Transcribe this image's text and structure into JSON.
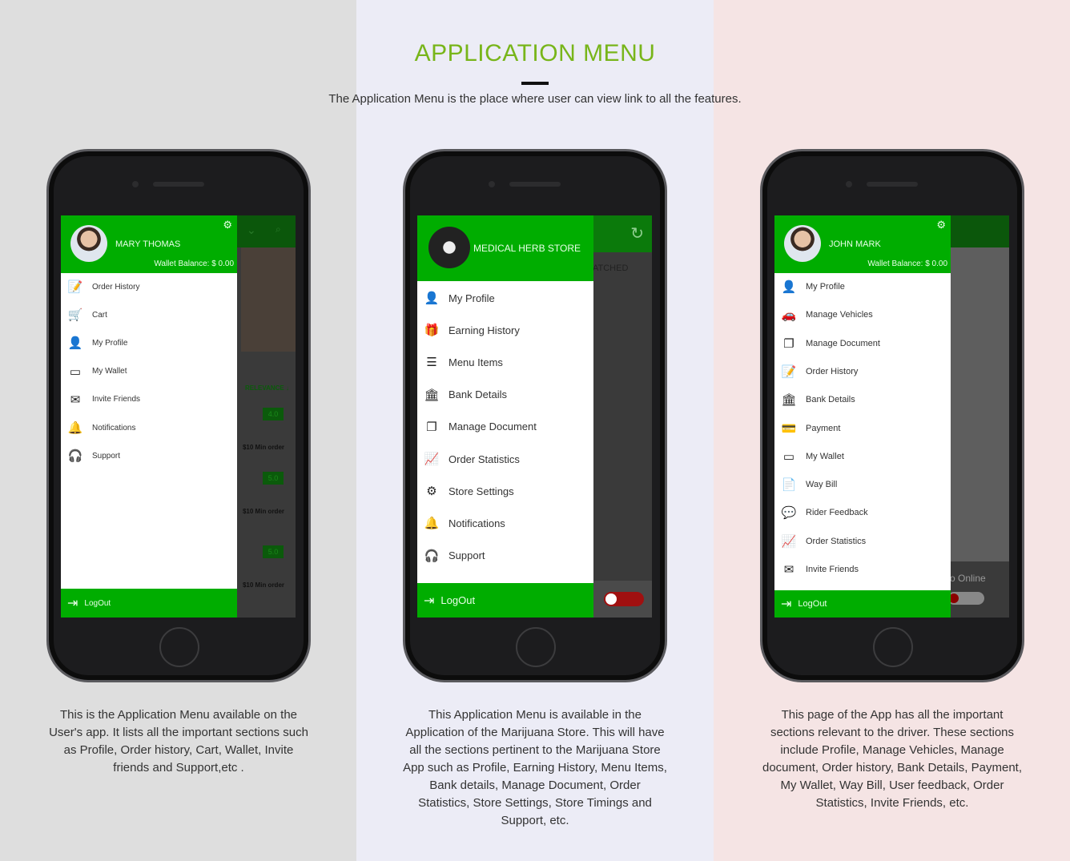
{
  "header": {
    "title": "APPLICATION MENU",
    "subtitle": "The Application Menu is the place where user can view link to all the features."
  },
  "colors": {
    "accent": "#78b51a",
    "drawer_green": "#00ad00"
  },
  "phones": [
    {
      "user": "MARY THOMAS",
      "wallet": "Wallet Balance: $ 0.00",
      "settings_icon": "gear-icon",
      "items": [
        {
          "label": "Order History",
          "icon": "clipboard-icon"
        },
        {
          "label": "Cart",
          "icon": "cart-icon"
        },
        {
          "label": "My Profile",
          "icon": "user-icon"
        },
        {
          "label": "My Wallet",
          "icon": "wallet-icon"
        },
        {
          "label": "Invite Friends",
          "icon": "envelope-icon"
        },
        {
          "label": "Notifications",
          "icon": "bell-icon"
        },
        {
          "label": "Support",
          "icon": "support-icon"
        }
      ],
      "logout": "LogOut",
      "background": {
        "sort": "RELEVANCE ↓",
        "ratings": [
          "4.0",
          "5.0",
          "5.0"
        ],
        "min_order": [
          "$10 Min order",
          "$10 Min order",
          "$10 Min order"
        ]
      },
      "description": "This is the Application Menu available on the User's app. It lists all the important sections such as Profile, Order history, Cart, Wallet, Invite friends and Support,etc ."
    },
    {
      "user": "MEDICAL HERB STORE",
      "items": [
        {
          "label": "My Profile",
          "icon": "user-icon"
        },
        {
          "label": "Earning History",
          "icon": "gift-icon"
        },
        {
          "label": "Menu Items",
          "icon": "list-icon"
        },
        {
          "label": "Bank Details",
          "icon": "bank-icon"
        },
        {
          "label": "Manage Document",
          "icon": "document-icon"
        },
        {
          "label": "Order Statistics",
          "icon": "chart-icon"
        },
        {
          "label": "Store Settings",
          "icon": "gear-icon"
        },
        {
          "label": "Notifications",
          "icon": "bell-icon"
        },
        {
          "label": "Support",
          "icon": "support-icon"
        }
      ],
      "logout": "LogOut",
      "background": {
        "tab": "ATCHED",
        "refresh_icon": "refresh-icon"
      },
      "description": "This Application Menu is available in the Application of the Marijuana Store. This will have all the sections pertinent to the Marijuana Store App such as Profile, Earning History, Menu Items, Bank details, Manage Document, Order Statistics, Store Settings, Store Timings and Support, etc."
    },
    {
      "user": "JOHN MARK",
      "wallet": "Wallet Balance: $ 0.00",
      "settings_icon": "gear-icon",
      "items": [
        {
          "label": "My Profile",
          "icon": "user-icon"
        },
        {
          "label": "Manage Vehicles",
          "icon": "car-icon"
        },
        {
          "label": "Manage Document",
          "icon": "document-icon"
        },
        {
          "label": "Order History",
          "icon": "clipboard-icon"
        },
        {
          "label": "Bank Details",
          "icon": "bank-icon"
        },
        {
          "label": "Payment",
          "icon": "card-icon"
        },
        {
          "label": "My Wallet",
          "icon": "wallet-icon"
        },
        {
          "label": "Way Bill",
          "icon": "bill-icon"
        },
        {
          "label": "Rider Feedback",
          "icon": "feedback-icon"
        },
        {
          "label": "Order Statistics",
          "icon": "chart-icon"
        },
        {
          "label": "Invite Friends",
          "icon": "envelope-icon"
        }
      ],
      "logout": "LogOut",
      "background": {
        "online": "o Online"
      },
      "description": "This page of the App has all the important sections relevant to the driver. These sections include Profile, Manage Vehicles, Manage document, Order history, Bank Details, Payment, My Wallet, Way Bill, User feedback, Order Statistics, Invite Friends, etc."
    }
  ]
}
